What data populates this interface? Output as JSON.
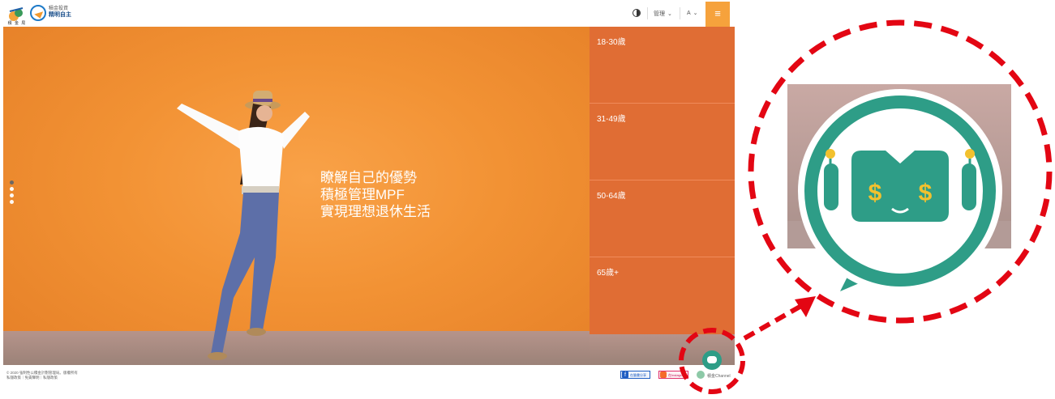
{
  "header": {
    "logo_mark_label": "積 金 局",
    "logo_title_small": "積金投資",
    "logo_title_main": "精明自主",
    "menu_admin": "管理",
    "menu_font": "A",
    "menu_icon": "hamburger-icon"
  },
  "hero": {
    "lines": [
      "瞭解自己的優勢",
      "積極管理MPF",
      "實現理想退休生活"
    ],
    "slide_count": 3,
    "active_slide": 0
  },
  "age_groups": [
    "18-30歲",
    "31-49歲",
    "50-64歲",
    "65歲+"
  ],
  "footer": {
    "copyright": "© 2020 強制性公積金計劃管理局。版權所有",
    "links": "私隱政策｜免責聲明｜私隱政策",
    "facebook_label": "在臉書分享",
    "instagram_label": "在Instagram",
    "chat_label": "積金Channel"
  },
  "annotation": {
    "bot_color": "#2e9d87",
    "highlight_color": "#e30613"
  },
  "colors": {
    "accent": "#f6a23c",
    "age_panel": "#e06d34",
    "hero": "#f29234"
  }
}
